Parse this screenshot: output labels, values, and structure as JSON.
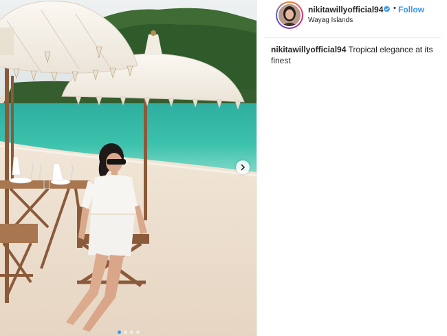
{
  "post": {
    "username": "nikitawillyofficial94",
    "separator": "•",
    "follow_label": "Follow",
    "location": "Wayag Islands",
    "caption_user": "nikitawillyofficial94",
    "caption_text": "Tropical elegance at its finest"
  },
  "carousel": {
    "slide_count": 4,
    "active_index": 0,
    "indicator_color": "#3897f0"
  },
  "icons": {
    "verified": "verified-badge-icon",
    "next": "chevron-right-icon"
  },
  "colors": {
    "follow": "#3897f0",
    "verified": "#3897f0",
    "divider": "#efefef"
  }
}
